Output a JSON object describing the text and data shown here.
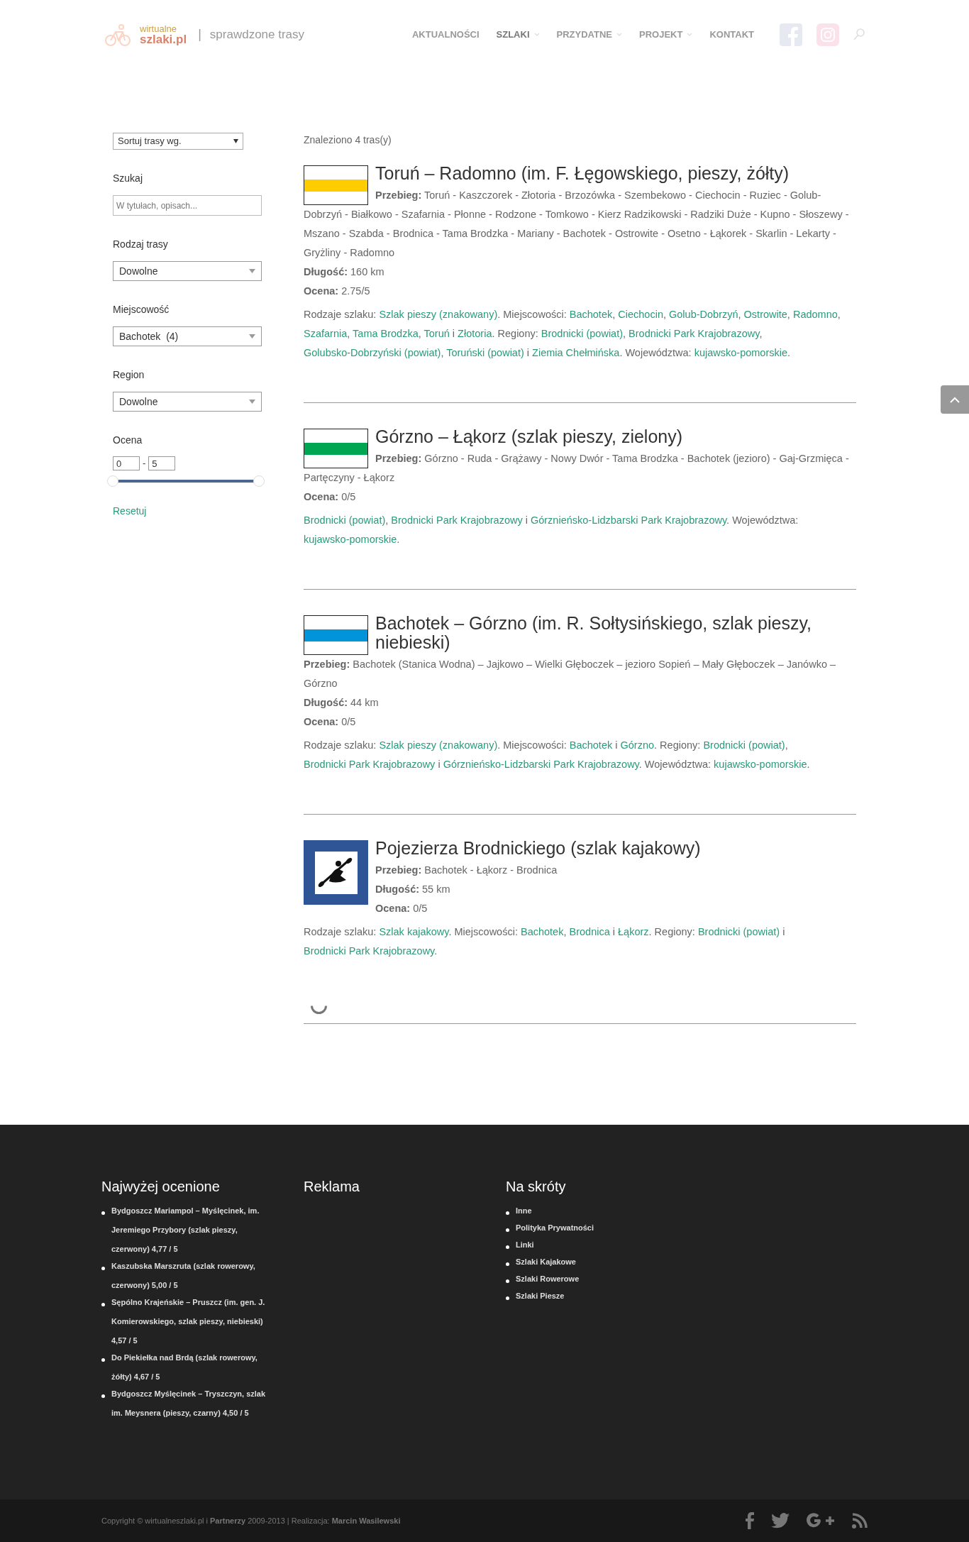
{
  "header": {
    "logo": {
      "top": "wirtualne",
      "bottom": "szlaki.pl"
    },
    "separator": "|",
    "tagline": "sprawdzone trasy",
    "nav": [
      {
        "label": "AKTUALNOŚCI",
        "selected": false,
        "has_menu": false
      },
      {
        "label": "SZLAKI",
        "selected": true,
        "has_menu": true
      },
      {
        "label": "PRZYDATNE",
        "selected": false,
        "has_menu": true
      },
      {
        "label": "PROJEKT",
        "selected": false,
        "has_menu": true
      },
      {
        "label": "KONTAKT",
        "selected": false,
        "has_menu": false
      }
    ]
  },
  "sidebar": {
    "sort": {
      "value": "Sortuj trasy wg."
    },
    "search": {
      "label": "Szukaj",
      "placeholder": "W tytułach, opisach..."
    },
    "filters": [
      {
        "label": "Rodzaj trasy",
        "value": "Dowolne"
      },
      {
        "label": "Miejscowość",
        "value": "Bachotek  (4)"
      },
      {
        "label": "Region",
        "value": "Dowolne"
      }
    ],
    "rating": {
      "label": "Ocena",
      "min": "0",
      "separator": "-",
      "max": "5",
      "level": 1
    },
    "reset": "Resetuj"
  },
  "results": {
    "summary": "Znaleziono 4 tras(y)",
    "routes": [
      {
        "title": "Toruń – Radomno (im. F. Łęgowskiego, pieszy, żółty)",
        "marker": {
          "kind": "stripe",
          "color": "#ffcc00"
        },
        "details": [
          "**Przebieg:** Toruń - Kaszczorek - Złotoria - Brzozówka - Szembekowo - Ciechocin - Ruziec - Golub-Dobrzyń - Białkowo - Szafarnia - Płonne - Rodzone - Tomkowo - Kierz Radzikowski - Radziki Duże - Kupno - Słoszewy - Mszano - Szabda - Brodnica - Tama Brodzka - Mariany - Bachotek - Ostrowite - Osetno - Łąkorek - Skarlin - Lekarty - Gryżliny - Radomno",
          "**Długość:** 160 km",
          "**Ocena:** 2.75/5"
        ],
        "tags": [
          {
            "text": "Rodzaje szlaku: ",
            "link": false
          },
          {
            "text": "Szlak pieszy (znakowany)",
            "link": true
          },
          {
            "text": ". Miejscowości: ",
            "link": false
          },
          {
            "text": "Bachotek",
            "link": true
          },
          {
            "text": ", ",
            "link": false
          },
          {
            "text": "Ciechocin",
            "link": true
          },
          {
            "text": ", ",
            "link": false
          },
          {
            "text": "Golub-Dobrzyń",
            "link": true
          },
          {
            "text": ", ",
            "link": false
          },
          {
            "text": "Ostrowite",
            "link": true
          },
          {
            "text": ", ",
            "link": false
          },
          {
            "text": "Radomno",
            "link": true
          },
          {
            "text": ", ",
            "link": false
          },
          {
            "text": "Szafarnia",
            "link": true
          },
          {
            "text": ", ",
            "link": false
          },
          {
            "text": "Tama Brodzka",
            "link": true
          },
          {
            "text": ", ",
            "link": false
          },
          {
            "text": "Toruń",
            "link": true
          },
          {
            "text": " i ",
            "link": false
          },
          {
            "text": "Złotoria",
            "link": true
          },
          {
            "text": ". Regiony: ",
            "link": false
          },
          {
            "text": "Brodnicki (powiat)",
            "link": true
          },
          {
            "text": ", ",
            "link": false
          },
          {
            "text": "Brodnicki Park Krajobrazowy",
            "link": true
          },
          {
            "text": ", ",
            "link": false
          },
          {
            "text": "Golubsko-Dobrzyński (powiat)",
            "link": true
          },
          {
            "text": ", ",
            "link": false
          },
          {
            "text": "Toruński (powiat)",
            "link": true
          },
          {
            "text": " i ",
            "link": false
          },
          {
            "text": "Ziemia Chełmińska",
            "link": true
          },
          {
            "text": ". Województwa: ",
            "link": false
          },
          {
            "text": "kujawsko-pomorskie",
            "link": true
          },
          {
            "text": ".",
            "link": false
          }
        ]
      },
      {
        "title": "Górzno – Łąkorz (szlak pieszy, zielony)",
        "marker": {
          "kind": "stripe",
          "color": "#00a651"
        },
        "details": [
          "**Przebieg:** Górzno - Ruda - Grążawy - Nowy Dwór - Tama Brodzka - Bachotek (jezioro) - Gaj-Grzmięca - Partęczyny - Łąkorz",
          "**Ocena:** 0/5"
        ],
        "tags": [
          {
            "text": "Brodnicki (powiat)",
            "link": true
          },
          {
            "text": ", ",
            "link": false
          },
          {
            "text": "Brodnicki Park Krajobrazowy",
            "link": true
          },
          {
            "text": " i ",
            "link": false
          },
          {
            "text": "Górznieńsko-Lidzbarski Park Krajobrazowy",
            "link": true
          },
          {
            "text": ". Województwa: ",
            "link": false
          },
          {
            "text": "kujawsko-pomorskie",
            "link": true
          },
          {
            "text": ".",
            "link": false
          }
        ]
      },
      {
        "title": "Bachotek – Górzno (im. R. Sołtysińskiego, szlak pieszy, niebieski)",
        "marker": {
          "kind": "stripe",
          "color": "#0095db"
        },
        "details": [
          "**Przebieg:** Bachotek (Stanica Wodna) – Jajkowo – Wielki Głęboczek – jezioro Sopień – Mały Głęboczek – Janówko – Górzno",
          "**Długość:** 44 km",
          "**Ocena:** 0/5"
        ],
        "tags": [
          {
            "text": "Rodzaje szlaku: ",
            "link": false
          },
          {
            "text": "Szlak pieszy (znakowany)",
            "link": true
          },
          {
            "text": ". Miejscowości: ",
            "link": false
          },
          {
            "text": "Bachotek",
            "link": true
          },
          {
            "text": " i ",
            "link": false
          },
          {
            "text": "Górzno",
            "link": true
          },
          {
            "text": ". Regiony: ",
            "link": false
          },
          {
            "text": "Brodnicki (powiat)",
            "link": true
          },
          {
            "text": ", ",
            "link": false
          },
          {
            "text": "Brodnicki Park Krajobrazowy",
            "link": true
          },
          {
            "text": " i ",
            "link": false
          },
          {
            "text": "Górznieńsko-Lidzbarski Park Krajobrazowy",
            "link": true
          },
          {
            "text": ". Województwa: ",
            "link": false
          },
          {
            "text": "kujawsko-pomorskie",
            "link": true
          },
          {
            "text": ".",
            "link": false
          }
        ]
      },
      {
        "title": "Pojezierza Brodnickiego (szlak kajakowy)",
        "marker": {
          "kind": "kayak",
          "color": "#2f5597"
        },
        "details": [
          "**Przebieg:** Bachotek - Łąkorz - Brodnica",
          "**Długość:** 55 km",
          "**Ocena:** 0/5"
        ],
        "tags": [
          {
            "text": "Rodzaje szlaku: ",
            "link": false
          },
          {
            "text": "Szlak kajakowy",
            "link": true
          },
          {
            "text": ". Miejscowości: ",
            "link": false
          },
          {
            "text": "Bachotek",
            "link": true
          },
          {
            "text": ", ",
            "link": false
          },
          {
            "text": "Brodnica",
            "link": true
          },
          {
            "text": " i ",
            "link": false
          },
          {
            "text": "Łąkorz",
            "link": true
          },
          {
            "text": ". Regiony: ",
            "link": false
          },
          {
            "text": "Brodnicki (powiat)",
            "link": true
          },
          {
            "text": " i ",
            "link": false
          },
          {
            "text": "Brodnicki Park Krajobrazowy",
            "link": true
          },
          {
            "text": ".",
            "link": false
          }
        ]
      }
    ]
  },
  "footer": {
    "columns": [
      {
        "title": "Najwyżej ocenione",
        "items": [
          "Bydgoszcz Mariampol – Myślęcinek, im. Jeremiego Przybory (szlak pieszy, czerwony) 4,77 / 5",
          "Kaszubska Marszruta (szlak rowerowy, czerwony) 5,00 / 5",
          "Sępólno Krajeńskie – Pruszcz (im. gen. J. Komierowskiego, szlak pieszy, niebieski) 4,57 / 5",
          "Do Piekiełka nad Brdą (szlak rowerowy, żółty) 4,67 / 5",
          "Bydgoszcz Myślęcinek – Tryszczyn, szlak im. Meysnera (pieszy, czarny) 4,50 / 5"
        ]
      },
      {
        "title": "Reklama"
      },
      {
        "title": "Na skróty",
        "items": [
          "Inne",
          "Polityka Prywatności",
          "Linki",
          "Szlaki Kajakowe",
          "Szlaki Rowerowe",
          "Szlaki Piesze"
        ]
      }
    ],
    "copyright": "Copyright © wirtualneszlaki.pl i **Partnerzy** 2009-2013 | Realizacja: **Marcin Wasilewski**",
    "social": [
      {
        "kind": "facebook"
      },
      {
        "kind": "twitter"
      },
      {
        "kind": "googleplus"
      },
      {
        "kind": "rss"
      }
    ]
  }
}
